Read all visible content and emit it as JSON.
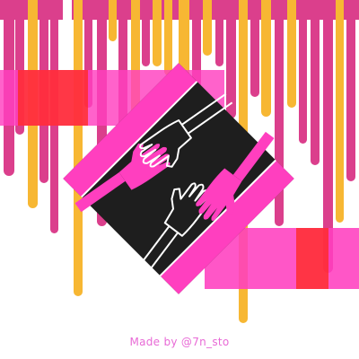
{
  "credit": {
    "text": "Made by @7n_sto",
    "color": "#e86ad6"
  },
  "artwork": {
    "icon": "hands-reaching-icon",
    "palette": {
      "magenta": "#db3f8c",
      "hot_pink": "#ff3fbf",
      "orange": "#f7b733",
      "red": "#ff2a1a",
      "dark": "#1e1e1e",
      "white": "#ffffff"
    }
  }
}
